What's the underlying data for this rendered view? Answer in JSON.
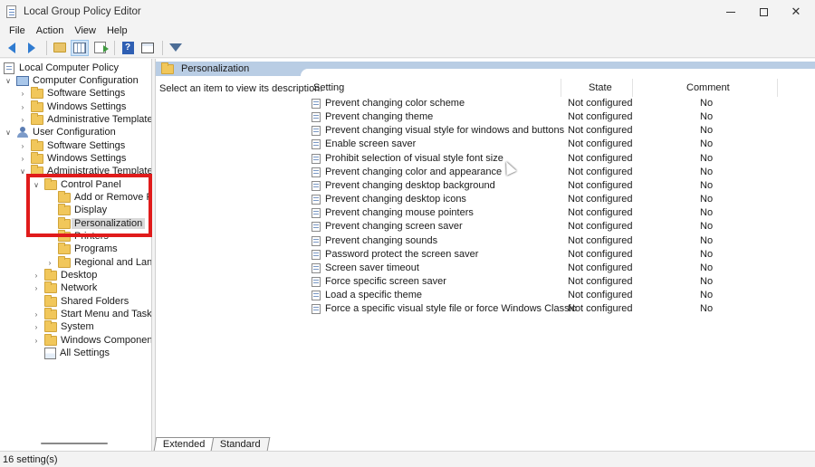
{
  "window": {
    "title": "Local Group Policy Editor",
    "controls": {
      "minimize": "—",
      "maximize": "☐",
      "close": "✕"
    }
  },
  "menu": [
    "File",
    "Action",
    "View",
    "Help"
  ],
  "toolbar": {
    "icons": [
      "back-icon",
      "forward-icon",
      "up-folder-icon",
      "show-hide-tree-icon",
      "export-list-icon",
      "help-icon",
      "properties-icon",
      "filter-icon"
    ],
    "help_glyph": "?"
  },
  "tree": {
    "items": [
      {
        "label": "Local Computer Policy",
        "chevron": "",
        "icon": "policy"
      },
      {
        "label": "Computer Configuration",
        "chevron": "∨",
        "icon": "computer"
      },
      {
        "label": "Software Settings",
        "chevron": "›",
        "icon": "folder"
      },
      {
        "label": "Windows Settings",
        "chevron": "›",
        "icon": "folder"
      },
      {
        "label": "Administrative Templates",
        "chevron": "›",
        "icon": "folder"
      },
      {
        "label": "User Configuration",
        "chevron": "∨",
        "icon": "user"
      },
      {
        "label": "Software Settings",
        "chevron": "›",
        "icon": "folder"
      },
      {
        "label": "Windows Settings",
        "chevron": "›",
        "icon": "folder"
      },
      {
        "label": "Administrative Templates",
        "chevron": "∨",
        "icon": "folder"
      },
      {
        "label": "Control Panel",
        "chevron": "∨",
        "icon": "folder"
      },
      {
        "label": "Add or Remove Pro",
        "chevron": "",
        "icon": "folder"
      },
      {
        "label": "Display",
        "chevron": "",
        "icon": "folder"
      },
      {
        "label": "Personalization",
        "chevron": "",
        "icon": "folder",
        "selected": true
      },
      {
        "label": "Printers",
        "chevron": "",
        "icon": "folder"
      },
      {
        "label": "Programs",
        "chevron": "",
        "icon": "folder"
      },
      {
        "label": "Regional and Langu",
        "chevron": "›",
        "icon": "folder"
      },
      {
        "label": "Desktop",
        "chevron": "›",
        "icon": "folder"
      },
      {
        "label": "Network",
        "chevron": "›",
        "icon": "folder"
      },
      {
        "label": "Shared Folders",
        "chevron": "",
        "icon": "folder"
      },
      {
        "label": "Start Menu and Taskbar",
        "chevron": "›",
        "icon": "folder"
      },
      {
        "label": "System",
        "chevron": "›",
        "icon": "folder"
      },
      {
        "label": "Windows Components",
        "chevron": "›",
        "icon": "folder"
      },
      {
        "label": "All Settings",
        "chevron": "",
        "icon": "allsettings"
      }
    ]
  },
  "details": {
    "header_title": "Personalization",
    "description": "Select an item to view its description.",
    "columns": {
      "setting": "Setting",
      "state": "State",
      "comment": "Comment"
    },
    "rows": [
      {
        "setting": "Prevent changing color scheme",
        "state": "Not configured",
        "comment": "No"
      },
      {
        "setting": "Prevent changing theme",
        "state": "Not configured",
        "comment": "No"
      },
      {
        "setting": "Prevent changing visual style for windows and buttons",
        "state": "Not configured",
        "comment": "No"
      },
      {
        "setting": "Enable screen saver",
        "state": "Not configured",
        "comment": "No"
      },
      {
        "setting": "Prohibit selection of visual style font size",
        "state": "Not configured",
        "comment": "No"
      },
      {
        "setting": "Prevent changing color and appearance",
        "state": "Not configured",
        "comment": "No"
      },
      {
        "setting": "Prevent changing desktop background",
        "state": "Not configured",
        "comment": "No"
      },
      {
        "setting": "Prevent changing desktop icons",
        "state": "Not configured",
        "comment": "No"
      },
      {
        "setting": "Prevent changing mouse pointers",
        "state": "Not configured",
        "comment": "No"
      },
      {
        "setting": "Prevent changing screen saver",
        "state": "Not configured",
        "comment": "No"
      },
      {
        "setting": "Prevent changing sounds",
        "state": "Not configured",
        "comment": "No"
      },
      {
        "setting": "Password protect the screen saver",
        "state": "Not configured",
        "comment": "No"
      },
      {
        "setting": "Screen saver timeout",
        "state": "Not configured",
        "comment": "No"
      },
      {
        "setting": "Force specific screen saver",
        "state": "Not configured",
        "comment": "No"
      },
      {
        "setting": "Load a specific theme",
        "state": "Not configured",
        "comment": "No"
      },
      {
        "setting": "Force a specific visual style file or force Windows Classic",
        "state": "Not configured",
        "comment": "No"
      }
    ]
  },
  "tabs": [
    "Extended",
    "Standard"
  ],
  "status": "16 setting(s)",
  "colors": {
    "highlight": "#e01b1b",
    "header_band": "#b9cde4",
    "folder": "#f1c75b"
  }
}
